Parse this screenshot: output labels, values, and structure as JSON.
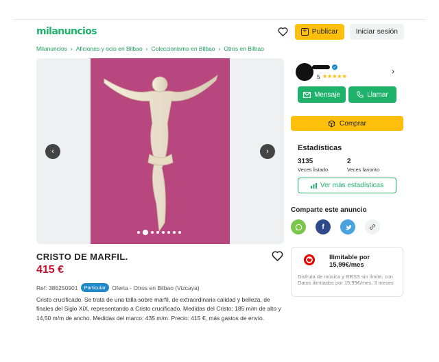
{
  "header": {
    "logo": "milanuncios",
    "publish_label": "Publicar",
    "login_label": "Iniciar sesión"
  },
  "breadcrumb": [
    "Milanuncios",
    "Aficiones y ocio en Bilbao",
    "Coleccionismo en Bilbao",
    "Otros en Bilbao"
  ],
  "gallery": {
    "image_count": 8,
    "active_index": 1,
    "photo_bg": "#b8467f"
  },
  "listing": {
    "title": "CRISTO DE MARFIL.",
    "price": "415 €",
    "ref": "Ref: 386250901",
    "badge": "Particular",
    "offer": "Oferta - Otros en Bilbao (Vizcaya)",
    "description": "Cristo crucificado. Se trata de una talla sobre marfil, de extraordinaria calidad y belleza, de finales del Siglo XiX, representando a Cristo crucificado. Medidas del Cristo: 185 m/m de alto y 14,50 m/m de ancho. Medidas del marco: 435 m/m. Precio: 415 €, más gastos de envío."
  },
  "seller": {
    "rating_count": "5",
    "rating": 4.5,
    "message_label": "Mensaje",
    "call_label": "Llamar",
    "buy_label": "Comprar"
  },
  "stats": {
    "title": "Estadísticas",
    "views": "3135",
    "views_label": "Veces listado",
    "favs": "2",
    "favs_label": "Veces favorito",
    "more_label": "Ver más estadísticas"
  },
  "share": {
    "title": "Comparte este anuncio",
    "networks": [
      "whatsapp",
      "facebook",
      "twitter",
      "link"
    ]
  },
  "ad": {
    "title": "Ilimitable por 15,99€/mes",
    "text": "Disfruta de música y RRSS sin límite, con Datos ilimitados por 15,99€/mes, 3 meses"
  },
  "colors": {
    "brand_green": "#1fb26b",
    "accent_yellow": "#fbbf0c",
    "price_red": "#c8102e"
  }
}
